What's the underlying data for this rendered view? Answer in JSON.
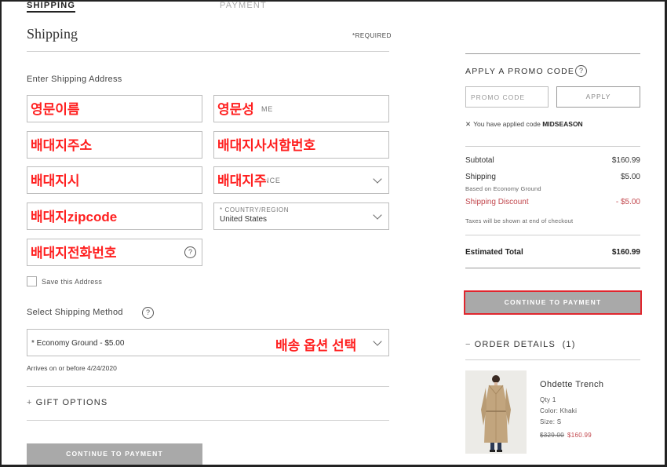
{
  "tabs": {
    "shipping": "SHIPPING",
    "payment": "PAYMENT"
  },
  "shipping": {
    "title": "Shipping",
    "required": "*REQUIRED",
    "address_label": "Enter Shipping Address",
    "fields": {
      "first_name": {
        "overlay": "영문이름"
      },
      "last_name": {
        "underlying": "ME",
        "overlay": "영문성"
      },
      "address1": {
        "overlay": "배대지주소"
      },
      "address2": {
        "overlay": "배대지사서함번호"
      },
      "city": {
        "overlay": "배대지시"
      },
      "state": {
        "underlying": "INCE",
        "overlay": "배대지주"
      },
      "zip": {
        "overlay": "배대지zipcode"
      },
      "country": {
        "label": "* COUNTRY/REGION",
        "value": "United States"
      },
      "phone": {
        "overlay": "배대지전화번호"
      }
    },
    "save_address": "Save this Address",
    "method_label": "Select Shipping Method",
    "method_value": "* Economy Ground - $5.00",
    "method_overlay": "배송 옵션 선택",
    "arrives": "Arrives on or before 4/24/2020",
    "gift_options": "GIFT OPTIONS",
    "continue_button": "CONTINUE TO PAYMENT"
  },
  "summary": {
    "promo_title": "APPLY A PROMO CODE",
    "promo_placeholder": "PROMO CODE",
    "apply_button": "APPLY",
    "applied_text": "You have applied code",
    "applied_code": "MIDSEASON",
    "subtotal_label": "Subtotal",
    "subtotal_value": "$160.99",
    "shipping_label": "Shipping",
    "shipping_note": "Based on Economy Ground",
    "shipping_value": "$5.00",
    "discount_label": "Shipping Discount",
    "discount_value": "- $5.00",
    "taxes_note": "Taxes will be shown at end of checkout",
    "total_label": "Estimated Total",
    "total_value": "$160.99",
    "continue_button": "CONTINUE TO PAYMENT",
    "order_details": "ORDER DETAILS",
    "order_count": "(1)"
  },
  "product": {
    "name": "Ohdette Trench",
    "qty": "Qty 1",
    "color": "Color: Khaki",
    "size": "Size: S",
    "old_price": "$329.00",
    "new_price": "$160.99"
  },
  "colors": {
    "accent_red": "#e0262e",
    "discount": "#c2474d",
    "button_grey": "#a9a9a9"
  }
}
